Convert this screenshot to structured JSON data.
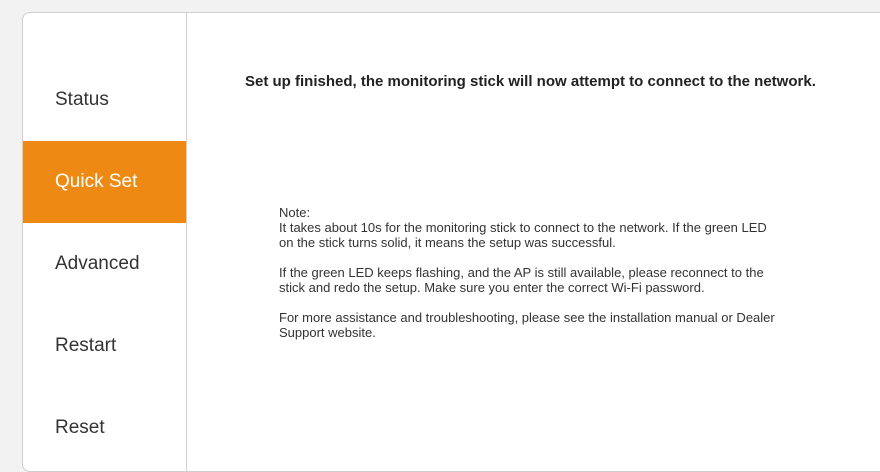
{
  "sidebar": {
    "items": [
      {
        "label": "Status"
      },
      {
        "label": "Quick Set",
        "active": true
      },
      {
        "label": "Advanced"
      },
      {
        "label": "Restart"
      },
      {
        "label": "Reset"
      }
    ]
  },
  "main": {
    "headline": "Set up finished, the monitoring stick will now attempt to connect to the network.",
    "note": {
      "label": "Note:",
      "paragraphs": [
        "   It takes about 10s for the monitoring stick to connect to the network. If the green LED on the stick turns solid, it means the setup was successful.",
        "   If the green LED keeps flashing, and the AP is still available, please reconnect to the stick and redo the setup. Make sure you enter the correct Wi-Fi password.",
        "   For more assistance and troubleshooting, please see the installation manual or Dealer Support website."
      ]
    }
  },
  "colors": {
    "accent": "#ee8a14",
    "border": "#cfcfcf",
    "background": "#f2f2f2"
  }
}
